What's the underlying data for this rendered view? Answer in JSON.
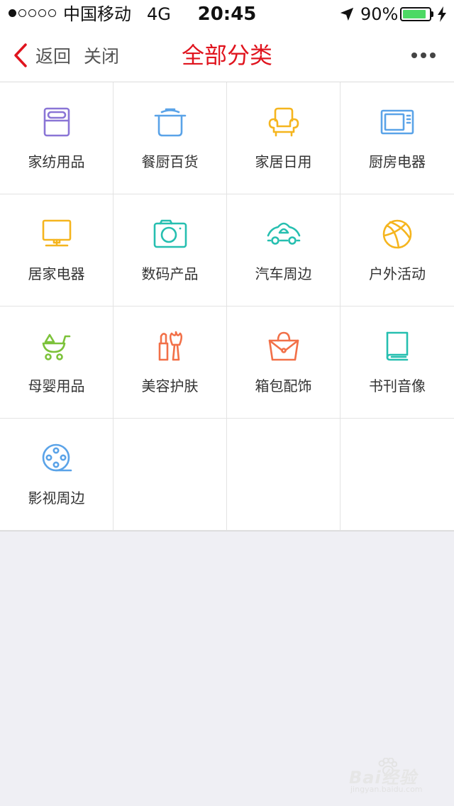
{
  "status_bar": {
    "carrier": "中国移动",
    "network": "4G",
    "time": "20:45",
    "battery_percent": "90%",
    "battery_level": 0.9,
    "battery_color": "#4cd964"
  },
  "nav": {
    "back_label": "返回",
    "close_label": "关闭",
    "title": "全部分类",
    "title_color": "#e0141e"
  },
  "categories": [
    {
      "label": "家纺用品",
      "icon": "bedding-icon",
      "color": "#8a75d6"
    },
    {
      "label": "餐厨百货",
      "icon": "pot-icon",
      "color": "#5aa3e8"
    },
    {
      "label": "家居日用",
      "icon": "armchair-icon",
      "color": "#f5b51e"
    },
    {
      "label": "厨房电器",
      "icon": "microwave-icon",
      "color": "#5aa3e8"
    },
    {
      "label": "居家电器",
      "icon": "monitor-icon",
      "color": "#f5b51e"
    },
    {
      "label": "数码产品",
      "icon": "camera-icon",
      "color": "#26bfb0"
    },
    {
      "label": "汽车周边",
      "icon": "car-icon",
      "color": "#26bfb0"
    },
    {
      "label": "户外活动",
      "icon": "basketball-icon",
      "color": "#f5b51e"
    },
    {
      "label": "母婴用品",
      "icon": "stroller-icon",
      "color": "#7cc23a"
    },
    {
      "label": "美容护肤",
      "icon": "lipstick-brush-icon",
      "color": "#f27048"
    },
    {
      "label": "箱包配饰",
      "icon": "handbag-icon",
      "color": "#f27048"
    },
    {
      "label": "书刊音像",
      "icon": "book-icon",
      "color": "#26bfb0"
    },
    {
      "label": "影视周边",
      "icon": "film-reel-icon",
      "color": "#5aa3e8"
    }
  ],
  "watermark": {
    "text": "Bai经验",
    "sub": "jingyan.baidu.com"
  }
}
